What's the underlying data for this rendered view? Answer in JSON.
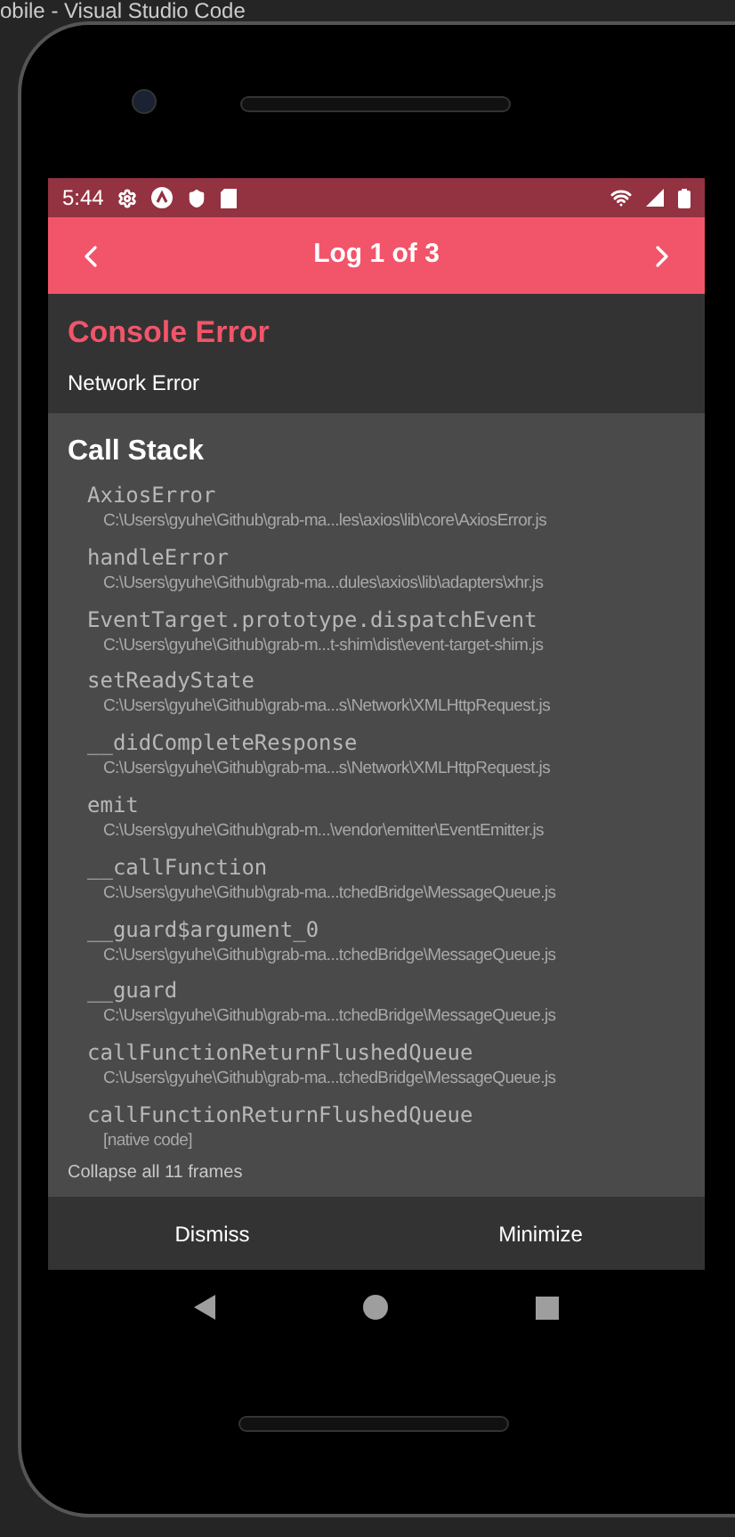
{
  "background_window": {
    "title": "obile - Visual Studio Code"
  },
  "status_bar": {
    "time": "5:44"
  },
  "header": {
    "title": "Log 1 of 3"
  },
  "error": {
    "title": "Console Error",
    "message": "Network Error"
  },
  "call_stack": {
    "title": "Call Stack",
    "frames": [
      {
        "name": "AxiosError",
        "location": "C:\\Users\\gyuhe\\Github\\grab-ma...les\\axios\\lib\\core\\AxiosError.js"
      },
      {
        "name": "handleError",
        "location": "C:\\Users\\gyuhe\\Github\\grab-ma...dules\\axios\\lib\\adapters\\xhr.js"
      },
      {
        "name": "EventTarget.prototype.dispatchEvent",
        "location": "C:\\Users\\gyuhe\\Github\\grab-m...t-shim\\dist\\event-target-shim.js"
      },
      {
        "name": "setReadyState",
        "location": "C:\\Users\\gyuhe\\Github\\grab-ma...s\\Network\\XMLHttpRequest.js"
      },
      {
        "name": "__didCompleteResponse",
        "location": "C:\\Users\\gyuhe\\Github\\grab-ma...s\\Network\\XMLHttpRequest.js"
      },
      {
        "name": "emit",
        "location": "C:\\Users\\gyuhe\\Github\\grab-m...\\vendor\\emitter\\EventEmitter.js"
      },
      {
        "name": "__callFunction",
        "location": "C:\\Users\\gyuhe\\Github\\grab-ma...tchedBridge\\MessageQueue.js"
      },
      {
        "name": "__guard$argument_0",
        "location": "C:\\Users\\gyuhe\\Github\\grab-ma...tchedBridge\\MessageQueue.js"
      },
      {
        "name": "__guard",
        "location": "C:\\Users\\gyuhe\\Github\\grab-ma...tchedBridge\\MessageQueue.js"
      },
      {
        "name": "callFunctionReturnFlushedQueue",
        "location": "C:\\Users\\gyuhe\\Github\\grab-ma...tchedBridge\\MessageQueue.js"
      },
      {
        "name": "callFunctionReturnFlushedQueue",
        "location": "[native code]"
      }
    ],
    "collapse_link": "Collapse all 11 frames"
  },
  "buttons": [
    "Dismiss",
    "Minimize"
  ]
}
